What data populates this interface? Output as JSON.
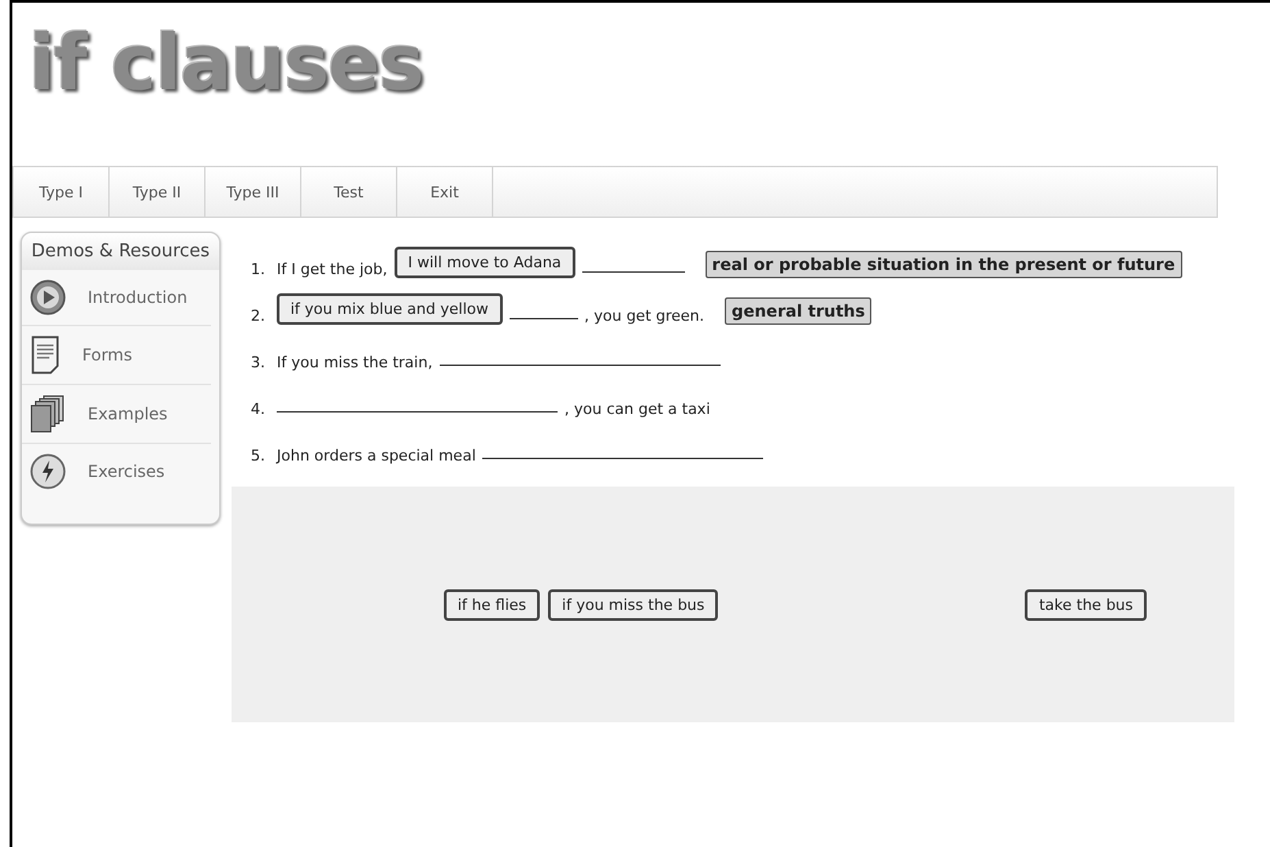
{
  "title": "if clauses",
  "tabs": [
    {
      "label": "Type I"
    },
    {
      "label": "Type II"
    },
    {
      "label": "Type III"
    },
    {
      "label": "Test"
    },
    {
      "label": "Exit"
    }
  ],
  "sidebar": {
    "heading": "Demos & Resources",
    "items": [
      {
        "label": "Introduction"
      },
      {
        "label": "Forms"
      },
      {
        "label": "Examples"
      },
      {
        "label": "Exercises"
      }
    ]
  },
  "exercises": [
    {
      "number": "1.",
      "parts": [
        {
          "kind": "text",
          "text": "If I get the job,"
        },
        {
          "kind": "answer",
          "text": "I will move to Adana"
        },
        {
          "kind": "blank"
        },
        {
          "kind": "label",
          "text": "real or probable situation in the present or future"
        }
      ]
    },
    {
      "number": "2.",
      "parts": [
        {
          "kind": "answer",
          "text": "if you mix blue and yellow"
        },
        {
          "kind": "blank"
        },
        {
          "kind": "text",
          "text": ", you get green."
        },
        {
          "kind": "label",
          "text": "general truths"
        }
      ]
    },
    {
      "number": "3.",
      "parts": [
        {
          "kind": "text",
          "text": "If you miss the train,"
        },
        {
          "kind": "blank"
        }
      ]
    },
    {
      "number": "4.",
      "parts": [
        {
          "kind": "blank"
        },
        {
          "kind": "text",
          "text": ", you can get a taxi"
        }
      ]
    },
    {
      "number": "5.",
      "parts": [
        {
          "kind": "text",
          "text": "John orders a special meal"
        },
        {
          "kind": "blank"
        }
      ]
    }
  ],
  "answer_pool": [
    "if he flies",
    "if you miss the bus",
    "take the bus"
  ]
}
